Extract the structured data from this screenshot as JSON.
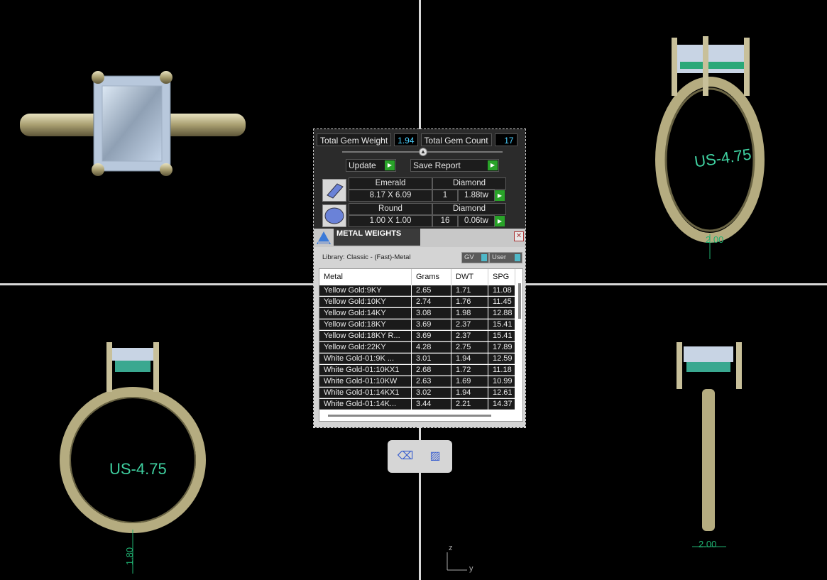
{
  "stats": {
    "total_gem_weight_label": "Total Gem Weight",
    "total_gem_weight_value": "1.94",
    "total_gem_count_label": "Total Gem Count",
    "total_gem_count_value": "17"
  },
  "buttons": {
    "update": "Update",
    "save_report": "Save Report"
  },
  "gems": [
    {
      "shape": "Emerald",
      "size": "8.17 X 6.09",
      "material": "Diamond",
      "count": "1",
      "weight": "1.88tw"
    },
    {
      "shape": "Round",
      "size": "1.00 X 1.00",
      "material": "Diamond",
      "count": "16",
      "weight": "0.06tw"
    }
  ],
  "metal_weights": {
    "title": "METAL WEIGHTS",
    "library": "Library: Classic - (Fast)-Metal",
    "toggles": [
      "GV",
      "User"
    ],
    "columns": [
      "Metal",
      "Grams",
      "DWT",
      "SPG"
    ],
    "rows": [
      [
        "Yellow Gold:9KY",
        "2.65",
        "1.71",
        "11.08"
      ],
      [
        "Yellow Gold:10KY",
        "2.74",
        "1.76",
        "11.45"
      ],
      [
        "Yellow Gold:14KY",
        "3.08",
        "1.98",
        "12.88"
      ],
      [
        "Yellow Gold:18KY",
        "3.69",
        "2.37",
        "15.41"
      ],
      [
        "Yellow Gold:18KY R...",
        "3.69",
        "2.37",
        "15.41"
      ],
      [
        "Yellow Gold:22KY",
        "4.28",
        "2.75",
        "17.89"
      ],
      [
        "White Gold-01:9K ...",
        "3.01",
        "1.94",
        "12.59"
      ],
      [
        "White Gold-01:10KX1",
        "2.68",
        "1.72",
        "11.18"
      ],
      [
        "White Gold-01:10KW",
        "2.63",
        "1.69",
        "10.99"
      ],
      [
        "White Gold-01:14KX1",
        "3.02",
        "1.94",
        "12.61"
      ],
      [
        "White Gold-01:14K...",
        "3.44",
        "2.21",
        "14.37"
      ]
    ]
  },
  "viewports": {
    "size_label_right": "US-4.75",
    "size_label_front": "US-4.75",
    "dim_top_right": "2.00",
    "dim_front": "1.80",
    "dim_side": "2.00",
    "axis_z": "z",
    "axis_y": "y"
  },
  "colors": {
    "metal": "#cfc8a0",
    "panel_bg": "#2b2b2b",
    "accent_green": "#29a329",
    "value_blue": "#4bd0ff"
  }
}
